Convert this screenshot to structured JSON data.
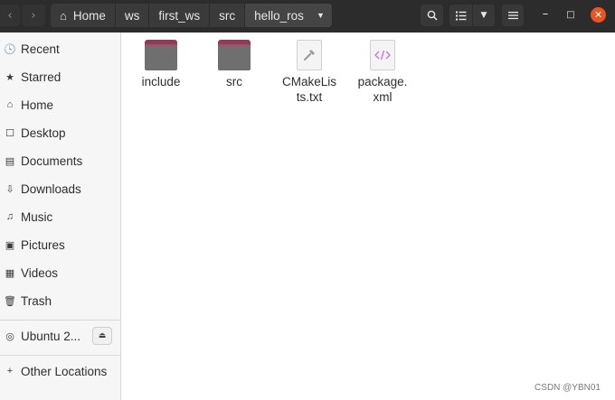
{
  "header": {
    "nav_back_icon": "chevron-left-icon",
    "nav_forward_icon": "chevron-right-icon",
    "breadcrumbs": [
      {
        "label": "Home",
        "icon": "home-icon"
      },
      {
        "label": "ws"
      },
      {
        "label": "first_ws"
      },
      {
        "label": "src"
      },
      {
        "label": "hello_ros",
        "current": true
      }
    ],
    "close_color": "#e9541f"
  },
  "sidebar": {
    "items": [
      {
        "label": "Recent",
        "glyph": "🕓",
        "icon": "recent-icon"
      },
      {
        "label": "Starred",
        "glyph": "★",
        "icon": "star-icon"
      },
      {
        "label": "Home",
        "glyph": "⌂",
        "icon": "home-icon"
      },
      {
        "label": "Desktop",
        "glyph": "☐",
        "icon": "desktop-icon"
      },
      {
        "label": "Documents",
        "glyph": "▤",
        "icon": "documents-icon"
      },
      {
        "label": "Downloads",
        "glyph": "⇩",
        "icon": "downloads-icon"
      },
      {
        "label": "Music",
        "glyph": "♫",
        "icon": "music-icon"
      },
      {
        "label": "Pictures",
        "glyph": "▣",
        "icon": "pictures-icon"
      },
      {
        "label": "Videos",
        "glyph": "▦",
        "icon": "videos-icon"
      },
      {
        "label": "Trash",
        "glyph": "🗑",
        "icon": "trash-icon"
      }
    ],
    "device": {
      "label": "Ubuntu 2...",
      "glyph": "◎",
      "icon": "disc-icon",
      "eject_icon": "eject-icon"
    },
    "other": {
      "label": "Other Locations",
      "glyph": "+",
      "icon": "plus-icon"
    }
  },
  "files": [
    {
      "label": "include",
      "type": "folder"
    },
    {
      "label": "src",
      "type": "folder"
    },
    {
      "label": "CMakeLis ts.txt",
      "type": "text",
      "icon": "cmake-file-icon"
    },
    {
      "label": "package. xml",
      "type": "xml",
      "icon": "xml-file-icon"
    }
  ],
  "colors": {
    "folder_tab": "#8a3e58",
    "folder_body": "#6f6f6f",
    "xml_accent": "#c678dd"
  },
  "watermark": "CSDN @YBN01"
}
